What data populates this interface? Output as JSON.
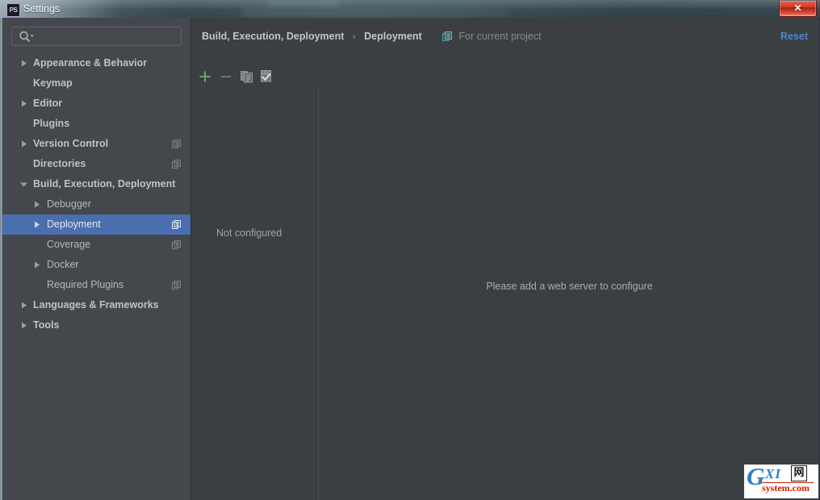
{
  "window": {
    "title": "Settings",
    "app_icon": "PS",
    "close_label": "✕"
  },
  "search": {
    "placeholder": "",
    "value": "",
    "icon": "search-icon"
  },
  "sidebar": {
    "items": [
      {
        "label": "Appearance & Behavior",
        "level": 0,
        "arrow": "right",
        "scope": false,
        "selected": false
      },
      {
        "label": "Keymap",
        "level": 0,
        "arrow": "none",
        "scope": false,
        "selected": false
      },
      {
        "label": "Editor",
        "level": 0,
        "arrow": "right",
        "scope": false,
        "selected": false
      },
      {
        "label": "Plugins",
        "level": 0,
        "arrow": "none",
        "scope": false,
        "selected": false
      },
      {
        "label": "Version Control",
        "level": 0,
        "arrow": "right",
        "scope": true,
        "selected": false
      },
      {
        "label": "Directories",
        "level": 0,
        "arrow": "none",
        "scope": true,
        "selected": false
      },
      {
        "label": "Build, Execution, Deployment",
        "level": 0,
        "arrow": "down",
        "scope": false,
        "selected": false
      },
      {
        "label": "Debugger",
        "level": 1,
        "arrow": "right",
        "scope": false,
        "selected": false
      },
      {
        "label": "Deployment",
        "level": 1,
        "arrow": "right",
        "scope": true,
        "selected": true
      },
      {
        "label": "Coverage",
        "level": 1,
        "arrow": "none",
        "scope": true,
        "selected": false
      },
      {
        "label": "Docker",
        "level": 1,
        "arrow": "right",
        "scope": false,
        "selected": false
      },
      {
        "label": "Required Plugins",
        "level": 1,
        "arrow": "none",
        "scope": true,
        "selected": false
      },
      {
        "label": "Languages & Frameworks",
        "level": 0,
        "arrow": "right",
        "scope": false,
        "selected": false
      },
      {
        "label": "Tools",
        "level": 0,
        "arrow": "right",
        "scope": false,
        "selected": false
      }
    ]
  },
  "header": {
    "breadcrumb_root": "Build, Execution, Deployment",
    "breadcrumb_separator": "›",
    "breadcrumb_leaf": "Deployment",
    "scope_note": "For current project",
    "scope_icon": "project-scope-icon",
    "reset_label": "Reset"
  },
  "toolbar": {
    "add_tooltip": "Add",
    "remove_tooltip": "Remove",
    "copy_tooltip": "Copy",
    "default_tooltip": "Use as default",
    "add_color": "#59a869",
    "disabled_color": "#6e7377",
    "icon_color": "#9aa0a5"
  },
  "server_list": {
    "empty_label": "Not configured"
  },
  "detail": {
    "empty_message": "Please add a web server to configure"
  },
  "watermark": {
    "g": "G",
    "xi": "XI",
    "cjk": "网",
    "sub": "system.com"
  },
  "colors": {
    "selection": "#4b6eaf",
    "sidebar_bg": "#44484d",
    "content_bg": "#3c3f41",
    "link": "#4d87d0",
    "text": "#bbbfc2"
  }
}
